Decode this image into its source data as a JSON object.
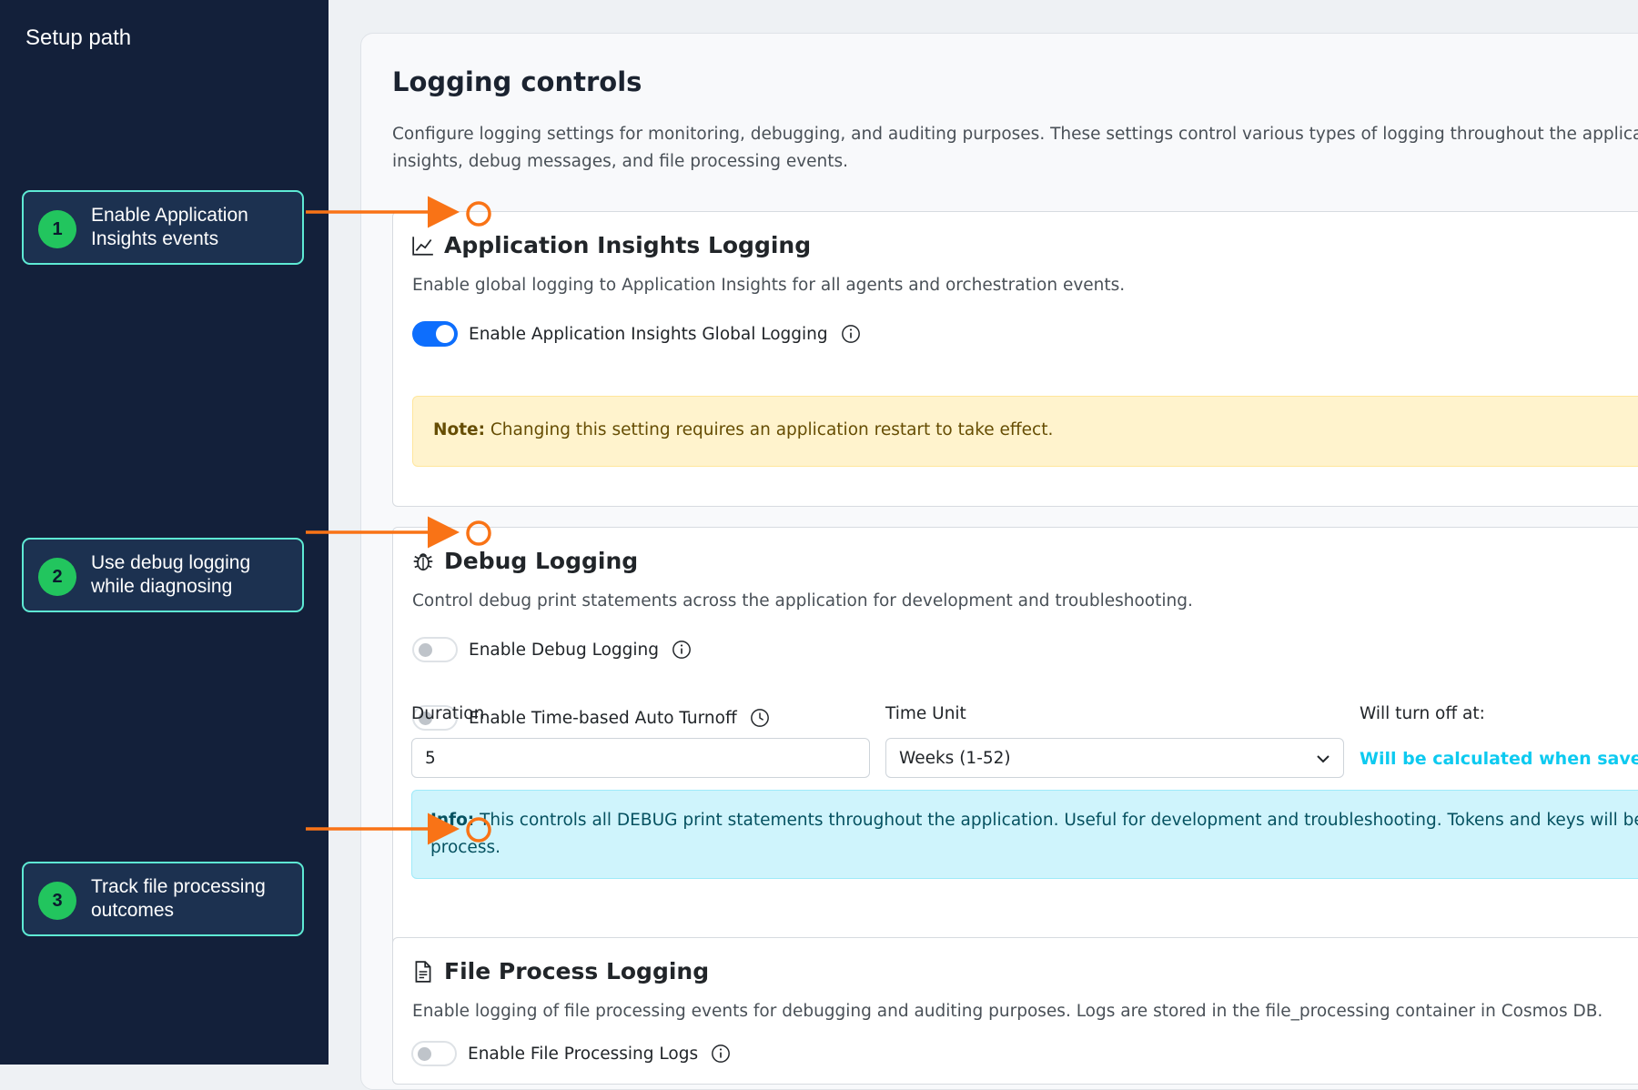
{
  "sidebar": {
    "title": "Setup path",
    "steps": [
      {
        "number": "1",
        "text": "Enable Application Insights events"
      },
      {
        "number": "2",
        "text": "Use debug logging while diagnosing"
      },
      {
        "number": "3",
        "text": "Track file processing outcomes"
      }
    ]
  },
  "page": {
    "title": "Logging controls",
    "description_line1": "Configure logging settings for monitoring, debugging, and auditing purposes. These settings control various types of logging throughout the application in",
    "description_line2": "insights, debug messages, and file processing events."
  },
  "app_insights": {
    "title": "Application Insights Logging",
    "description": "Enable global logging to Application Insights for all agents and orchestration events.",
    "toggle_label": "Enable Application Insights Global Logging",
    "toggle_on": true,
    "note_label": "Note:",
    "note_text": "Changing this setting requires an application restart to take effect."
  },
  "debug": {
    "title": "Debug Logging",
    "description": "Control debug print statements across the application for development and troubleshooting.",
    "toggle_label": "Enable Debug Logging",
    "toggle_on": false,
    "auto_turnoff_label": "Enable Time-based Auto Turnoff",
    "auto_turnoff_on": false,
    "duration_label": "Duration",
    "duration_value": "5",
    "time_unit_label": "Time Unit",
    "time_unit_value": "Weeks (1-52)",
    "turn_off_label": "Will turn off at:",
    "turn_off_value": "Will be calculated when saved",
    "info_label": "Info:",
    "info_text": "This controls all DEBUG print statements throughout the application. Useful for development and troubleshooting. Tokens and keys will be collect",
    "info_text_line2": "process."
  },
  "file_process": {
    "title": "File Process Logging",
    "description": "Enable logging of file processing events for debugging and auditing purposes. Logs are stored in the file_processing container in Cosmos DB.",
    "toggle_label": "Enable File Processing Logs",
    "toggle_on": false
  },
  "colors": {
    "sidebar_bg": "#13203a",
    "step_border": "#5eead4",
    "step_badge": "#22c55e",
    "annotation_orange": "#f97316",
    "toggle_on": "#0d6efd",
    "calc_text": "#0dcaf0"
  },
  "icons": [
    "chart-line-icon",
    "bug-icon",
    "file-text-icon",
    "info-circle-icon",
    "clock-icon",
    "chevron-down-icon"
  ]
}
